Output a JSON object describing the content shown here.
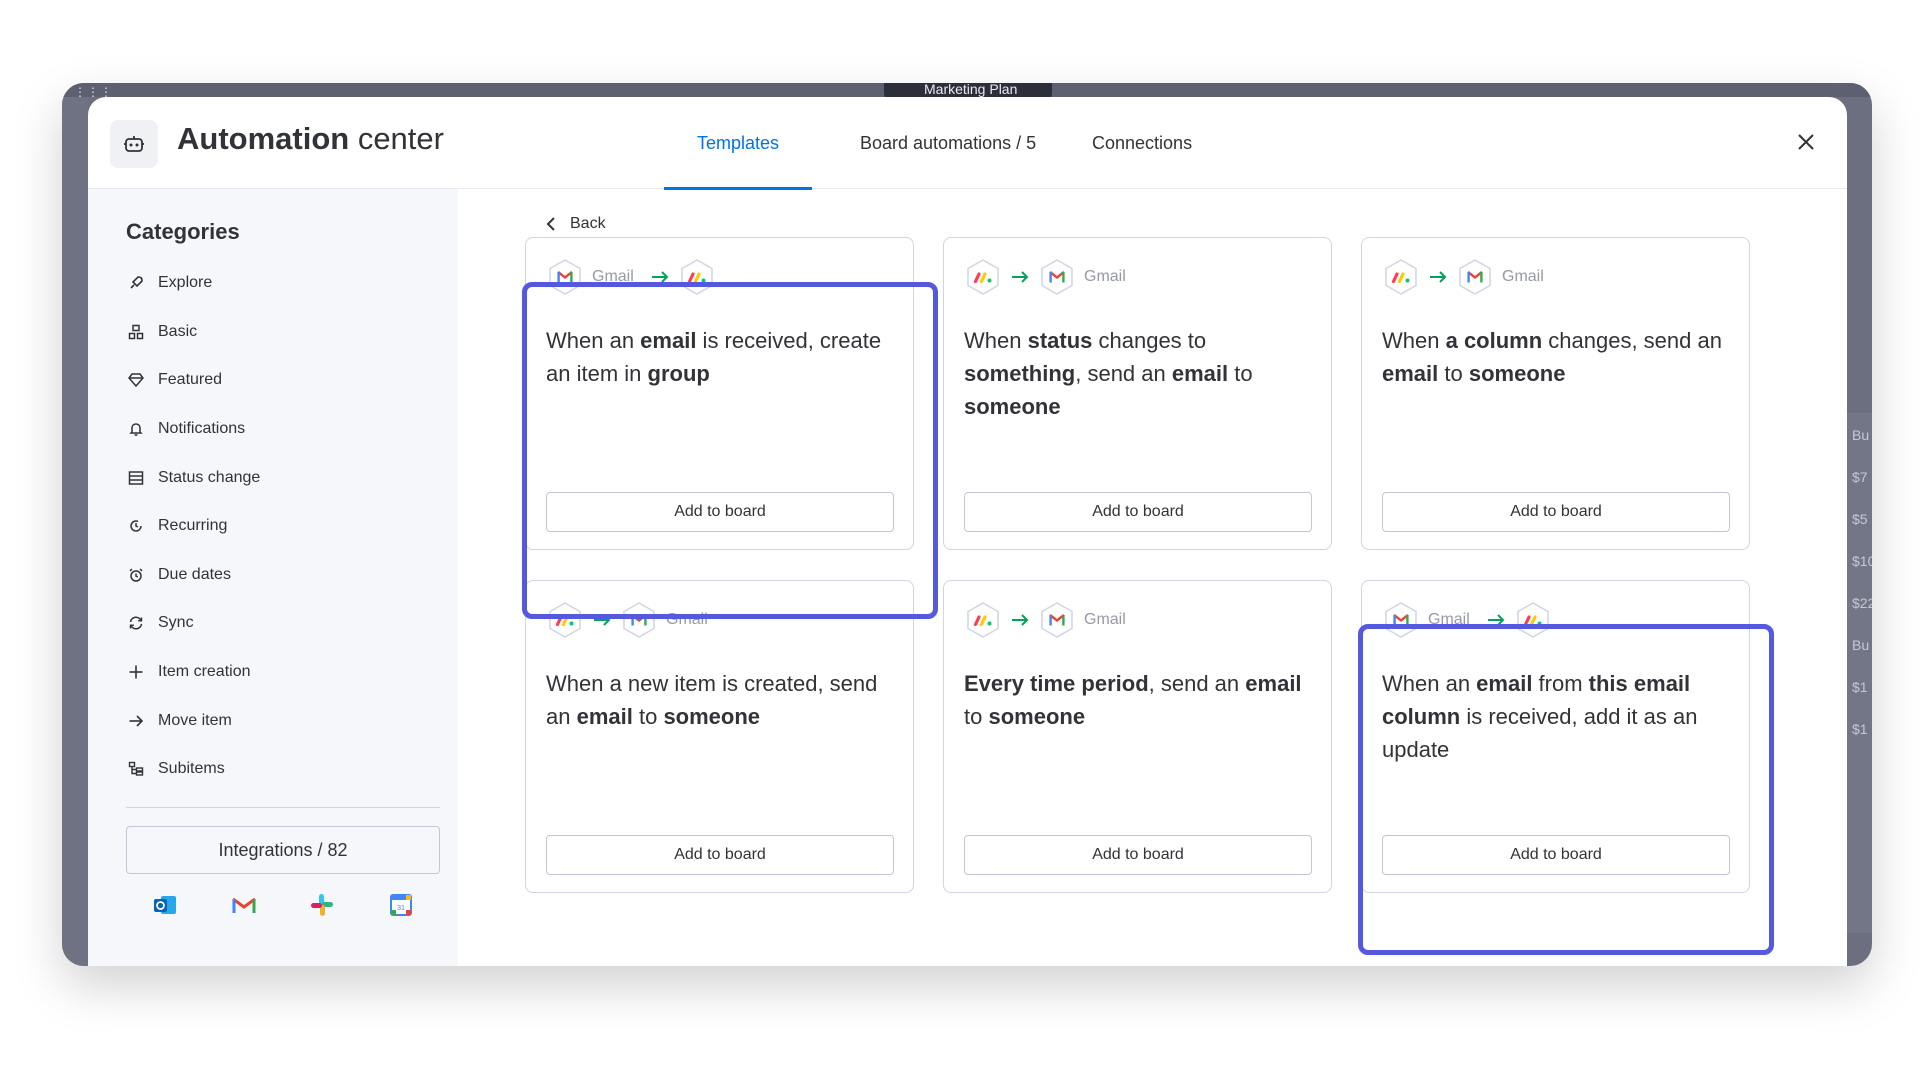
{
  "background": {
    "board_name": "Marketing Plan",
    "right_column_fragments": [
      "Bu",
      "$7",
      "$5",
      "$10",
      "$22",
      "Bu",
      "$1",
      "$1"
    ]
  },
  "header": {
    "title_bold": "Automation",
    "title_rest": " center",
    "tabs": [
      {
        "label": "Templates",
        "active": true
      },
      {
        "label": "Board automations / 5",
        "active": false
      },
      {
        "label": "Connections",
        "active": false
      }
    ],
    "close_icon": "close-icon",
    "robot_icon": "robot-icon"
  },
  "sidebar": {
    "title": "Categories",
    "items": [
      {
        "label": "Explore",
        "icon": "rocket-icon"
      },
      {
        "label": "Basic",
        "icon": "basic-icon"
      },
      {
        "label": "Featured",
        "icon": "diamond-icon"
      },
      {
        "label": "Notifications",
        "icon": "bell-icon"
      },
      {
        "label": "Status change",
        "icon": "status-icon"
      },
      {
        "label": "Recurring",
        "icon": "recurring-icon"
      },
      {
        "label": "Due dates",
        "icon": "alarm-icon"
      },
      {
        "label": "Sync",
        "icon": "sync-icon"
      },
      {
        "label": "Item creation",
        "icon": "plus-icon"
      },
      {
        "label": "Move item",
        "icon": "arrow-right-icon"
      },
      {
        "label": "Subitems",
        "icon": "subitems-icon"
      }
    ],
    "integrations_label": "Integrations / 82",
    "integration_icons": [
      "outlook-icon",
      "gmail-icon",
      "slack-icon",
      "google-calendar-icon"
    ]
  },
  "main": {
    "back_label": "Back",
    "gmail_label": "Gmail",
    "add_label": "Add to board",
    "cards": [
      {
        "flow": "gmail-to-monday",
        "parts": [
          [
            "When an ",
            false
          ],
          [
            "email",
            true
          ],
          [
            " is received, create an item in ",
            false
          ],
          [
            "group",
            true
          ]
        ]
      },
      {
        "flow": "monday-to-gmail",
        "parts": [
          [
            "When ",
            false
          ],
          [
            "status",
            true
          ],
          [
            " changes to ",
            false
          ],
          [
            "something",
            true
          ],
          [
            ", send an ",
            false
          ],
          [
            "email",
            true
          ],
          [
            " to ",
            false
          ],
          [
            "someone",
            true
          ]
        ]
      },
      {
        "flow": "monday-to-gmail",
        "parts": [
          [
            "When ",
            false
          ],
          [
            "a column",
            true
          ],
          [
            " changes, send an ",
            false
          ],
          [
            "email",
            true
          ],
          [
            " to ",
            false
          ],
          [
            "someone",
            true
          ]
        ]
      },
      {
        "flow": "monday-to-gmail",
        "parts": [
          [
            "When a new item is created, send an ",
            false
          ],
          [
            "email",
            true
          ],
          [
            " to ",
            false
          ],
          [
            "someone",
            true
          ]
        ]
      },
      {
        "flow": "monday-to-gmail",
        "parts": [
          [
            "Every time period",
            true
          ],
          [
            ", send an ",
            false
          ],
          [
            "email",
            true
          ],
          [
            " to ",
            false
          ],
          [
            "someone",
            true
          ]
        ]
      },
      {
        "flow": "gmail-to-monday",
        "parts": [
          [
            "When an ",
            false
          ],
          [
            "email",
            true
          ],
          [
            " from ",
            false
          ],
          [
            "this email column",
            true
          ],
          [
            " is received, add it as an update",
            false
          ]
        ]
      }
    ],
    "highlighted_cards": [
      0,
      5
    ]
  },
  "colors": {
    "accent": "#0073ea",
    "highlight": "#5559df",
    "gmail_red": "#ea4335",
    "monday_red": "#ff3d57",
    "monday_yellow": "#ffcb00",
    "monday_green": "#00ca72",
    "arrow_green": "#00a359"
  }
}
